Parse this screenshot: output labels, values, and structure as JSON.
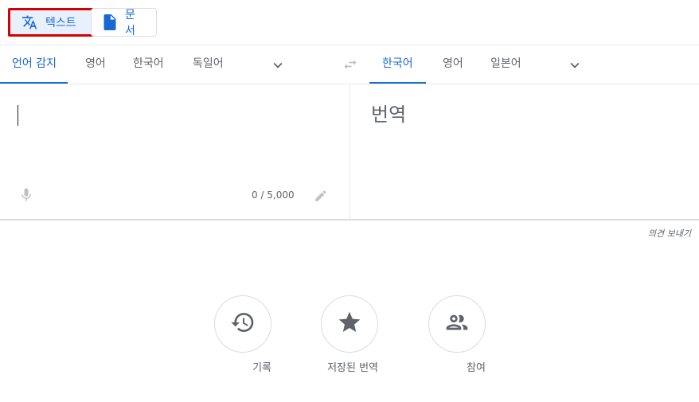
{
  "modes": {
    "text_label": "텍스트",
    "document_label": "문서"
  },
  "source_langs": {
    "detect": "언어 감지",
    "items": [
      "영어",
      "한국어",
      "독일어"
    ]
  },
  "target_langs": {
    "items": [
      "한국어",
      "영어",
      "일본어"
    ]
  },
  "source": {
    "char_count": "0 / 5,000"
  },
  "target": {
    "placeholder": "번역"
  },
  "feedback_label": "의견 보내기",
  "actions": {
    "history": "기록",
    "saved": "저장된 번역",
    "contribute": "참여"
  },
  "colors": {
    "accent": "#1967d2",
    "highlight_border": "#d50000",
    "icon_gray": "#5f6368"
  }
}
